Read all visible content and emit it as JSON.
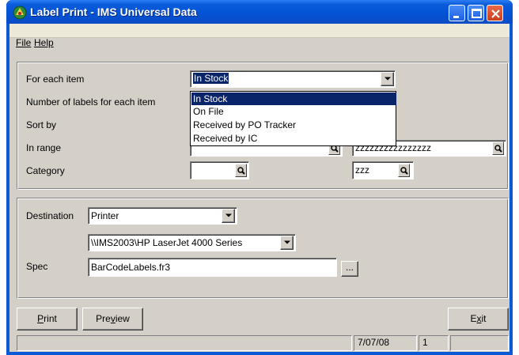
{
  "window": {
    "title": "Label Print - IMS Universal Data"
  },
  "menu": {
    "file": "File",
    "help": "Help"
  },
  "selection": {
    "for_each_item_label": "For each item",
    "for_each_item_value": "In Stock",
    "num_labels_label": "Number of labels for each item",
    "sort_by_label": "Sort by",
    "in_range_label": "In range",
    "in_range_to": "zzzzzzzzzzzzzzzz",
    "category_label": "Category",
    "category_from": "",
    "category_to": "zzz",
    "dropdown_options": [
      "In Stock",
      "On File",
      "Received by PO Tracker",
      "Received by IC"
    ]
  },
  "output": {
    "destination_label": "Destination",
    "destination_value": "Printer",
    "printer_value": "\\\\IMS2003\\HP LaserJet 4000 Series",
    "spec_label": "Spec",
    "spec_value": "BarCodeLabels.fr3",
    "browse_label": "..."
  },
  "buttons": {
    "print_ul": "P",
    "print_rest": "rint",
    "preview_pre": "Pre",
    "preview_ul": "v",
    "preview_post": "iew",
    "exit_pre": "E",
    "exit_ul": "x",
    "exit_post": "it"
  },
  "status": {
    "date": "7/07/08",
    "count": "1"
  },
  "colors": {
    "title_bar": "#0a5ad6",
    "dialog_bg": "#d4d0c8",
    "selected": "#0a246a"
  },
  "icons": {
    "app": "app-icon",
    "search": "search-icon",
    "dropdown": "chevron-down-icon"
  }
}
